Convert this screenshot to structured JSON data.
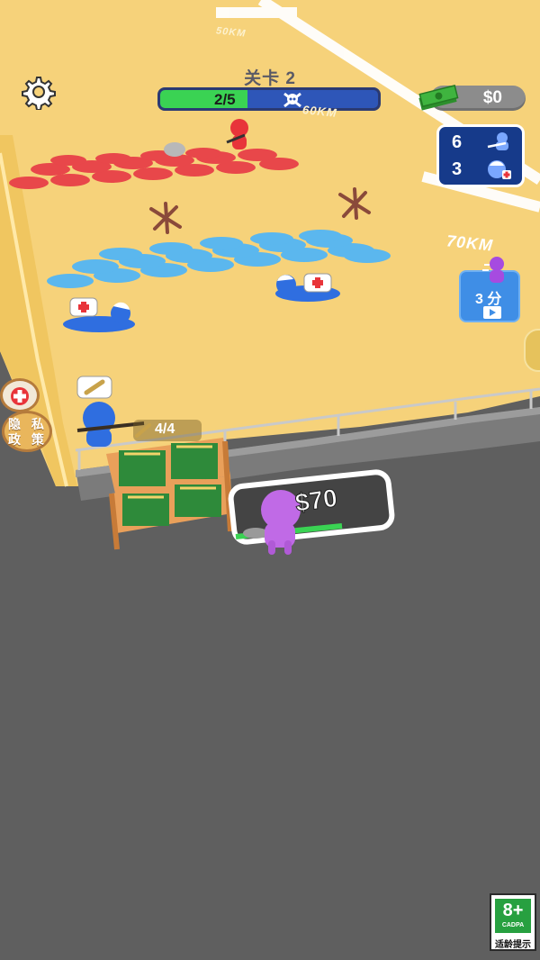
{
  "hud": {
    "settings_icon": "gear-icon",
    "level_title": "关卡 2",
    "wave_progress": {
      "label": "2/5",
      "current": 2,
      "total": 5,
      "icon": "skull-crossbones-icon"
    },
    "money": {
      "label": "$0",
      "icon": "cash-stack-icon"
    },
    "army": {
      "soldiers": {
        "count": "6",
        "icon": "blue-soldier-icon"
      },
      "wounded": {
        "count": "3",
        "icon": "wounded-soldier-icon"
      }
    }
  },
  "map": {
    "distance_marker_1": "70KM",
    "distance_marker_2": "60KM",
    "distance_marker_3": "50KM"
  },
  "recruit_card": {
    "label": "3 分",
    "icon": "video-ad-icon"
  },
  "side_buttons": {
    "medic_icon": "red-cross-icon",
    "privacy_label": "隐 私 政 策"
  },
  "ammo_station": {
    "count_label": "4/4",
    "request_icon": "bullet-icon"
  },
  "purchase_zone": {
    "price_label": "$70",
    "progress": 0.75
  },
  "age_rating": {
    "rating": "8+",
    "org": "CADPA",
    "note": "适龄提示"
  },
  "colors": {
    "sand": "#f6d27a",
    "asphalt": "#5f5f5f",
    "progress_green": "#3ad353",
    "progress_blue": "#2e56b8",
    "panel_blue": "#163a8a",
    "enemy_red": "#e74a4a",
    "ally_blue": "#4aa7e8",
    "player_purple": "#c06ae6"
  }
}
